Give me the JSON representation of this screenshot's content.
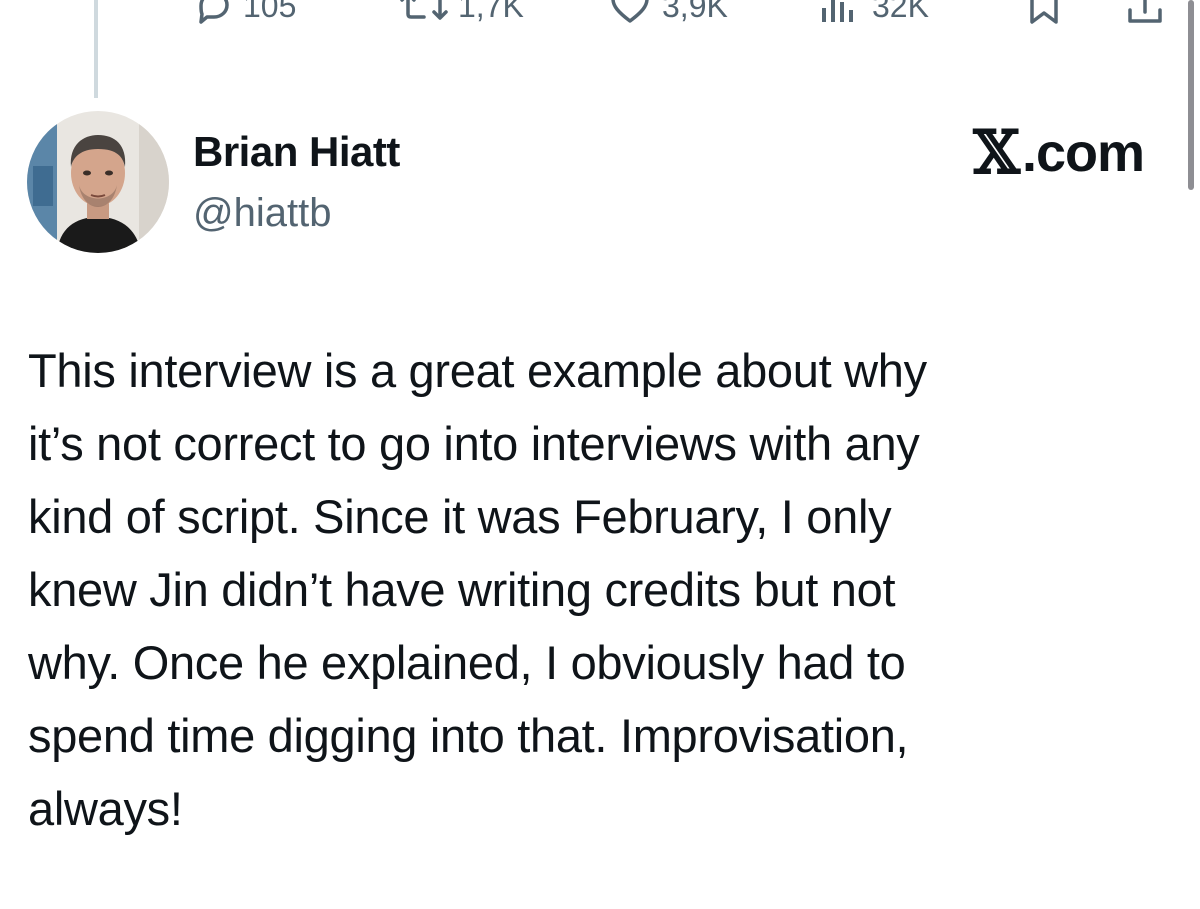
{
  "actions": {
    "reply_count": "105",
    "repost_count": "1,7K",
    "like_count": "3,9K",
    "views_count": "32K"
  },
  "tweet": {
    "author_name": "Brian Hiatt",
    "author_handle": "@hiattb",
    "source_x": "𝕏",
    "source_domain": ".com",
    "text_lines": [
      "This interview is a great example about why",
      "it’s not correct to go into interviews with any",
      "kind of script. Since it was February, I only",
      "knew Jin didn’t have writing credits but not",
      "why. Once he explained, I obviously had to",
      "spend time digging into that. Improvisation,",
      "always!"
    ]
  },
  "icons": {
    "reply": "comment-icon",
    "repost": "retweet-icon",
    "like": "heart-icon",
    "views": "views-icon",
    "bookmark": "bookmark-icon",
    "share": "share-icon"
  },
  "colors": {
    "text": "#0f1419",
    "secondary": "#536471",
    "thread_line": "#cfd9de"
  }
}
